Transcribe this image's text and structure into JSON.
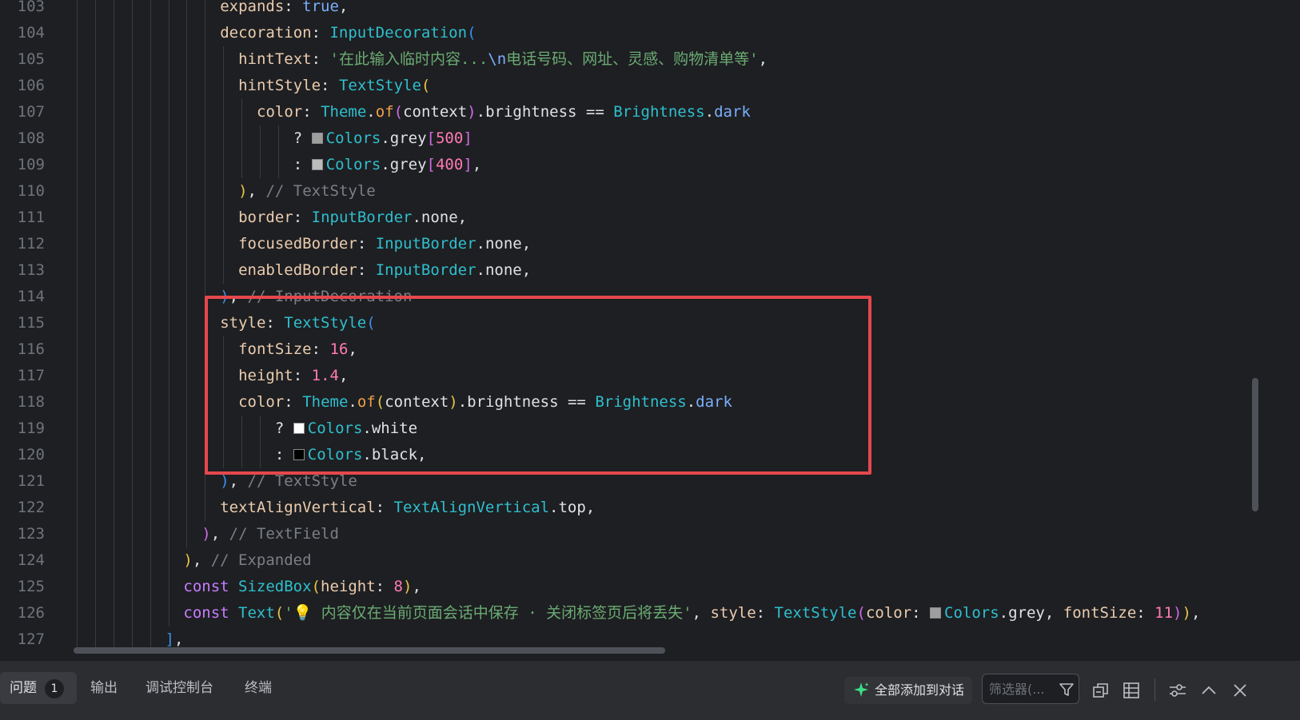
{
  "colors": {
    "keyword": "#cf8e6d",
    "prop": "#eaccaf",
    "type": "#2fbfce",
    "string": "#6aab73",
    "number": "#ff7ab4",
    "comment": "#7a7e85",
    "plain": "#dfe1e5",
    "bracket1": "#e8c548",
    "bracket2": "#d16ae8",
    "bracket3": "#3b8eea",
    "method": "#f0a14a",
    "fieldBlue": "#7aaefe",
    "constKw": "#c77dff",
    "highlight": "#e5484d"
  },
  "editor": {
    "lines": [
      {
        "num": "103",
        "indent": 8,
        "tokens": [
          [
            "expands",
            "prop"
          ],
          [
            ": ",
            "plain"
          ],
          [
            "true",
            "fieldBlue"
          ],
          [
            ",",
            "plain"
          ]
        ]
      },
      {
        "num": "104",
        "indent": 8,
        "tokens": [
          [
            "decoration",
            "prop"
          ],
          [
            ": ",
            "plain"
          ],
          [
            "InputDecoration",
            "type"
          ],
          [
            "(",
            "bracket3"
          ]
        ]
      },
      {
        "num": "105",
        "indent": 9,
        "tokens": [
          [
            "hintText",
            "prop"
          ],
          [
            ": ",
            "plain"
          ],
          [
            "'在此输入临时内容...",
            "string"
          ],
          [
            "\\n",
            "fieldBlue"
          ],
          [
            "电话号码、网址、灵感、购物清单等'",
            "string"
          ],
          [
            ",",
            "plain"
          ]
        ]
      },
      {
        "num": "106",
        "indent": 9,
        "tokens": [
          [
            "hintStyle",
            "prop"
          ],
          [
            ": ",
            "plain"
          ],
          [
            "TextStyle",
            "type"
          ],
          [
            "(",
            "bracket1"
          ]
        ]
      },
      {
        "num": "107",
        "indent": 10,
        "tokens": [
          [
            "color",
            "prop"
          ],
          [
            ": ",
            "plain"
          ],
          [
            "Theme",
            "type"
          ],
          [
            ".",
            "plain"
          ],
          [
            "of",
            "method"
          ],
          [
            "(",
            "bracket2"
          ],
          [
            "context",
            "plain"
          ],
          [
            ")",
            "bracket2"
          ],
          [
            ".brightness == ",
            "plain"
          ],
          [
            "Brightness",
            "type"
          ],
          [
            ".",
            "plain"
          ],
          [
            "dark",
            "fieldBlue"
          ]
        ]
      },
      {
        "num": "108",
        "indent": 12,
        "tokens": [
          [
            "? ",
            "plain"
          ],
          [
            "#9e9e9e",
            "swatch"
          ],
          [
            "Colors",
            "type"
          ],
          [
            ".grey",
            "plain"
          ],
          [
            "[",
            "bracket2"
          ],
          [
            "500",
            "number"
          ],
          [
            "]",
            "bracket2"
          ]
        ]
      },
      {
        "num": "109",
        "indent": 12,
        "tokens": [
          [
            ": ",
            "plain"
          ],
          [
            "#bdbdbd",
            "swatch"
          ],
          [
            "Colors",
            "type"
          ],
          [
            ".grey",
            "plain"
          ],
          [
            "[",
            "bracket2"
          ],
          [
            "400",
            "number"
          ],
          [
            "]",
            "bracket2"
          ],
          [
            ",",
            "plain"
          ]
        ]
      },
      {
        "num": "110",
        "indent": 9,
        "tokens": [
          [
            ")",
            "bracket1"
          ],
          [
            ", ",
            "plain"
          ],
          [
            "// TextStyle",
            "comment"
          ]
        ]
      },
      {
        "num": "111",
        "indent": 9,
        "tokens": [
          [
            "border",
            "prop"
          ],
          [
            ": ",
            "plain"
          ],
          [
            "InputBorder",
            "type"
          ],
          [
            ".none,",
            "plain"
          ]
        ]
      },
      {
        "num": "112",
        "indent": 9,
        "tokens": [
          [
            "focusedBorder",
            "prop"
          ],
          [
            ": ",
            "plain"
          ],
          [
            "InputBorder",
            "type"
          ],
          [
            ".none,",
            "plain"
          ]
        ]
      },
      {
        "num": "113",
        "indent": 9,
        "tokens": [
          [
            "enabledBorder",
            "prop"
          ],
          [
            ": ",
            "plain"
          ],
          [
            "InputBorder",
            "type"
          ],
          [
            ".none,",
            "plain"
          ]
        ]
      },
      {
        "num": "114",
        "indent": 8,
        "tokens": [
          [
            ")",
            "bracket3"
          ],
          [
            ", ",
            "plain"
          ],
          [
            "// InputDecoration",
            "comment"
          ]
        ]
      },
      {
        "num": "115",
        "indent": 8,
        "tokens": [
          [
            "style",
            "prop"
          ],
          [
            ": ",
            "plain"
          ],
          [
            "TextStyle",
            "type"
          ],
          [
            "(",
            "bracket3"
          ]
        ]
      },
      {
        "num": "116",
        "indent": 9,
        "tokens": [
          [
            "fontSize",
            "prop"
          ],
          [
            ": ",
            "plain"
          ],
          [
            "16",
            "number"
          ],
          [
            ",",
            "plain"
          ]
        ]
      },
      {
        "num": "117",
        "indent": 9,
        "tokens": [
          [
            "height",
            "prop"
          ],
          [
            ": ",
            "plain"
          ],
          [
            "1.4",
            "number"
          ],
          [
            ",",
            "plain"
          ]
        ]
      },
      {
        "num": "118",
        "indent": 9,
        "tokens": [
          [
            "color",
            "prop"
          ],
          [
            ": ",
            "plain"
          ],
          [
            "Theme",
            "type"
          ],
          [
            ".",
            "plain"
          ],
          [
            "of",
            "method"
          ],
          [
            "(",
            "bracket1"
          ],
          [
            "context",
            "plain"
          ],
          [
            ")",
            "bracket1"
          ],
          [
            ".brightness == ",
            "plain"
          ],
          [
            "Brightness",
            "type"
          ],
          [
            ".",
            "plain"
          ],
          [
            "dark",
            "fieldBlue"
          ]
        ]
      },
      {
        "num": "119",
        "indent": 11,
        "tokens": [
          [
            "? ",
            "plain"
          ],
          [
            "#ffffff",
            "swatch"
          ],
          [
            "Colors",
            "type"
          ],
          [
            ".white",
            "plain"
          ]
        ]
      },
      {
        "num": "120",
        "indent": 11,
        "tokens": [
          [
            ": ",
            "plain"
          ],
          [
            "#000000",
            "swatch"
          ],
          [
            "Colors",
            "type"
          ],
          [
            ".black,",
            "plain"
          ]
        ]
      },
      {
        "num": "121",
        "indent": 8,
        "tokens": [
          [
            ")",
            "bracket3"
          ],
          [
            ", ",
            "plain"
          ],
          [
            "// TextStyle",
            "comment"
          ]
        ]
      },
      {
        "num": "122",
        "indent": 8,
        "tokens": [
          [
            "textAlignVertical",
            "prop"
          ],
          [
            ": ",
            "plain"
          ],
          [
            "TextAlignVertical",
            "type"
          ],
          [
            ".top,",
            "plain"
          ]
        ]
      },
      {
        "num": "123",
        "indent": 7,
        "tokens": [
          [
            ")",
            "bracket2"
          ],
          [
            ", ",
            "plain"
          ],
          [
            "// TextField",
            "comment"
          ]
        ]
      },
      {
        "num": "124",
        "indent": 6,
        "tokens": [
          [
            ")",
            "bracket1"
          ],
          [
            ", ",
            "plain"
          ],
          [
            "// Expanded",
            "comment"
          ]
        ]
      },
      {
        "num": "125",
        "indent": 6,
        "tokens": [
          [
            "const ",
            "constKw"
          ],
          [
            "SizedBox",
            "type"
          ],
          [
            "(",
            "bracket1"
          ],
          [
            "height",
            "prop"
          ],
          [
            ": ",
            "plain"
          ],
          [
            "8",
            "number"
          ],
          [
            ")",
            "bracket1"
          ],
          [
            ",",
            "plain"
          ]
        ]
      },
      {
        "num": "126",
        "indent": 6,
        "tokens": [
          [
            "const ",
            "constKw"
          ],
          [
            "Text",
            "type"
          ],
          [
            "(",
            "bracket1"
          ],
          [
            "'💡 内容仅在当前页面会话中保存 · 关闭标签页后将丢失'",
            "string"
          ],
          [
            ", ",
            "plain"
          ],
          [
            "style",
            "prop"
          ],
          [
            ": ",
            "plain"
          ],
          [
            "TextStyle",
            "type"
          ],
          [
            "(",
            "bracket2"
          ],
          [
            "color",
            "prop"
          ],
          [
            ": ",
            "plain"
          ],
          [
            "#9e9e9e",
            "swatch"
          ],
          [
            "Colors",
            "type"
          ],
          [
            ".grey, ",
            "plain"
          ],
          [
            "fontSize",
            "prop"
          ],
          [
            ": ",
            "plain"
          ],
          [
            "11",
            "number"
          ],
          [
            ")",
            "bracket2"
          ],
          [
            ")",
            "bracket1"
          ],
          [
            ",",
            "plain"
          ]
        ]
      },
      {
        "num": "127",
        "indent": 5,
        "tokens": [
          [
            "]",
            "bracket3"
          ],
          [
            ",",
            "plain"
          ]
        ]
      }
    ]
  },
  "panel": {
    "tabs": [
      {
        "label": "问题",
        "badge": "1",
        "active": true
      },
      {
        "label": "输出"
      },
      {
        "label": "调试控制台"
      },
      {
        "label": "终端"
      }
    ],
    "add_all_label": "全部添加到对话",
    "filter_placeholder": "筛选器(..."
  }
}
